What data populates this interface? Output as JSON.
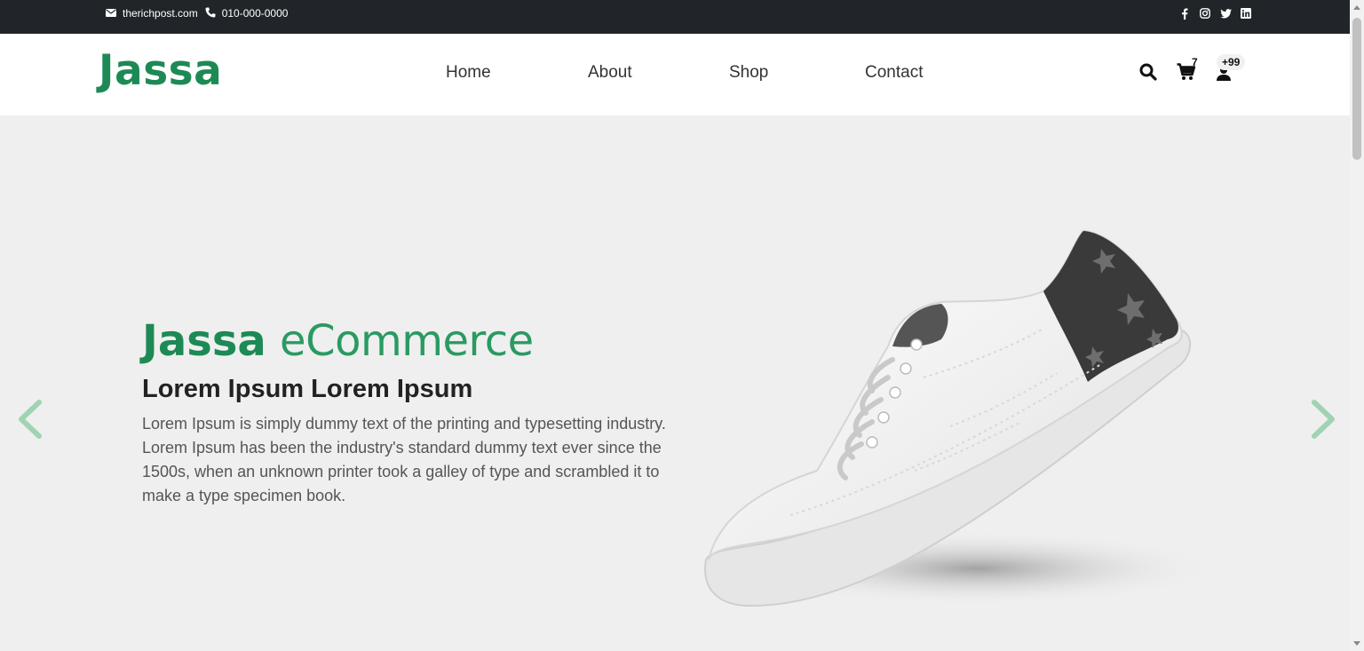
{
  "topbar": {
    "email": "therichpost.com",
    "phone": "010-000-0000",
    "email_icon": "envelope-icon",
    "phone_icon": "phone-icon",
    "social": [
      "facebook-icon",
      "instagram-icon",
      "twitter-icon",
      "linkedin-icon"
    ]
  },
  "navbar": {
    "brand": "Jassa",
    "links": [
      "Home",
      "About",
      "Shop",
      "Contact"
    ],
    "cart_count": "7",
    "user_count": "+99",
    "icons": [
      "search-icon",
      "cart-icon",
      "user-icon"
    ]
  },
  "hero": {
    "title_bold": "Jassa",
    "title_light": "eCommerce",
    "subtitle": "Lorem Ipsum Lorem Ipsum",
    "text": "Lorem Ipsum is simply dummy text of the printing and typesetting industry. Lorem Ipsum has been the industry's standard dummy text ever since the 1500s, when an unknown printer took a galley of type and scrambled it to make a type specimen book.",
    "prev_icon": "chevron-left-icon",
    "next_icon": "chevron-right-icon"
  },
  "colors": {
    "brand": "#1d8a55",
    "topbar_bg": "#212529",
    "hero_bg": "#efefef",
    "arrow": "#9fd3b3"
  }
}
